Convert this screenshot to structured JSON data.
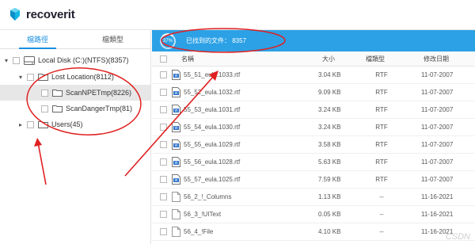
{
  "app": {
    "name": "recoverit"
  },
  "sidebar": {
    "tabs": [
      {
        "label": "檔路徑"
      },
      {
        "label": "檔類型"
      }
    ],
    "tree": [
      {
        "label": "Local Disk (C:)(NTFS)(8357)"
      },
      {
        "label": "Lost Location(8112)"
      },
      {
        "label": "ScanNPETmp(8226)"
      },
      {
        "label": "ScanDangerTmp(81)"
      },
      {
        "label": "Users(45)"
      }
    ]
  },
  "status": {
    "progress": "37%",
    "found_text": "已找到的文件：  8357"
  },
  "table": {
    "columns": {
      "name": "名稱",
      "size": "大小",
      "type": "檔類型",
      "date": "修改日期"
    },
    "rows": [
      {
        "name": "55_51_eula.1033.rtf",
        "size": "3.04  KB",
        "type": "RTF",
        "date": "11-07-2007"
      },
      {
        "name": "55_52_eula.1032.rtf",
        "size": "9.09  KB",
        "type": "RTF",
        "date": "11-07-2007"
      },
      {
        "name": "55_53_eula.1031.rtf",
        "size": "3.24  KB",
        "type": "RTF",
        "date": "11-07-2007"
      },
      {
        "name": "55_54_eula.1030.rtf",
        "size": "3.24  KB",
        "type": "RTF",
        "date": "11-07-2007"
      },
      {
        "name": "55_55_eula.1029.rtf",
        "size": "3.58  KB",
        "type": "RTF",
        "date": "11-07-2007"
      },
      {
        "name": "55_56_eula.1028.rtf",
        "size": "5.63  KB",
        "type": "RTF",
        "date": "11-07-2007"
      },
      {
        "name": "55_57_eula.1025.rtf",
        "size": "7.59  KB",
        "type": "RTF",
        "date": "11-07-2007"
      },
      {
        "name": "56_2_!_Columns",
        "size": "1.13  KB",
        "type": "--",
        "date": "11-16-2021"
      },
      {
        "name": "56_3_!UIText",
        "size": "0.05  KB",
        "type": "--",
        "date": "11-16-2021"
      },
      {
        "name": "56_4_!File",
        "size": "4.10  KB",
        "type": "--",
        "date": "11-16-2021"
      }
    ]
  },
  "watermark": "CSDN"
}
